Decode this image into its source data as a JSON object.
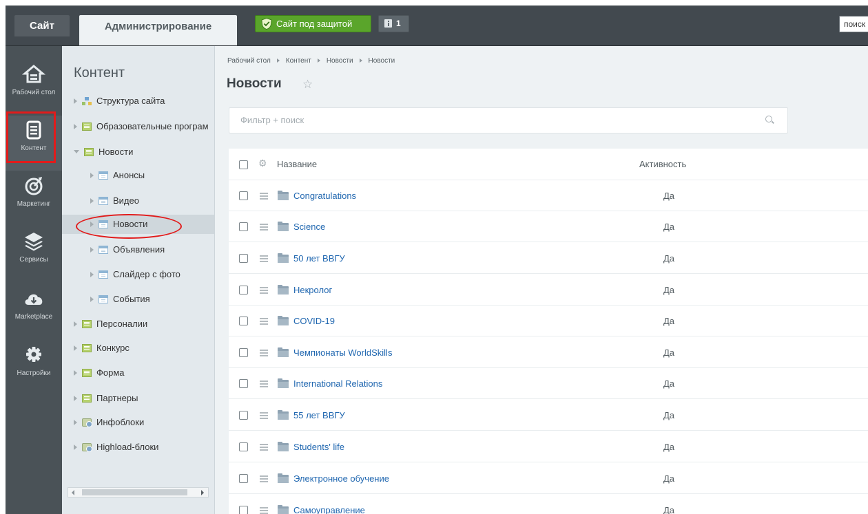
{
  "topbar": {
    "site_tab": "Сайт",
    "admin_tab": "Администрирование",
    "protect_label": "Сайт под защитой",
    "notif_count": "1",
    "search_text": "поиск"
  },
  "iconmenu": [
    {
      "label": "Рабочий стол",
      "icon": "home-icon"
    },
    {
      "label": "Контент",
      "icon": "document-icon"
    },
    {
      "label": "Маркетинг",
      "icon": "target-icon"
    },
    {
      "label": "Сервисы",
      "icon": "layers-icon"
    },
    {
      "label": "Marketplace",
      "icon": "cloud-download-icon"
    },
    {
      "label": "Настройки",
      "icon": "gear-icon"
    }
  ],
  "tree": {
    "title": "Контент",
    "items": [
      {
        "label": "Структура сайта"
      },
      {
        "label": "Образовательные програм"
      },
      {
        "label": "Новости"
      },
      {
        "label": "Анонсы"
      },
      {
        "label": "Видео"
      },
      {
        "label": "Новости"
      },
      {
        "label": "Объявления"
      },
      {
        "label": "Слайдер с фото"
      },
      {
        "label": "События"
      },
      {
        "label": "Персоналии"
      },
      {
        "label": "Конкурс"
      },
      {
        "label": "Форма"
      },
      {
        "label": "Партнеры"
      },
      {
        "label": "Инфоблоки"
      },
      {
        "label": "Highload-блоки"
      }
    ]
  },
  "breadcrumb": [
    "Рабочий стол",
    "Контент",
    "Новости",
    "Новости"
  ],
  "page": {
    "title": "Новости",
    "filter_placeholder": "Фильтр + поиск"
  },
  "grid": {
    "columns": {
      "name": "Название",
      "active": "Активность"
    },
    "rows": [
      {
        "name": "Congratulations",
        "active": "Да"
      },
      {
        "name": "Science",
        "active": "Да"
      },
      {
        "name": "50 лет ВВГУ",
        "active": "Да"
      },
      {
        "name": "Некролог",
        "active": "Да"
      },
      {
        "name": "COVID-19",
        "active": "Да"
      },
      {
        "name": "Чемпионаты WorldSkills",
        "active": "Да"
      },
      {
        "name": "International Relations",
        "active": "Да"
      },
      {
        "name": "55 лет ВВГУ",
        "active": "Да"
      },
      {
        "name": "Students' life",
        "active": "Да"
      },
      {
        "name": "Электронное обучение",
        "active": "Да"
      },
      {
        "name": "Самоуправление",
        "active": "Да"
      }
    ]
  },
  "colors": {
    "accent_green": "#5aa52b",
    "link_blue": "#2067b0",
    "highlight_red": "#e21b1b"
  }
}
